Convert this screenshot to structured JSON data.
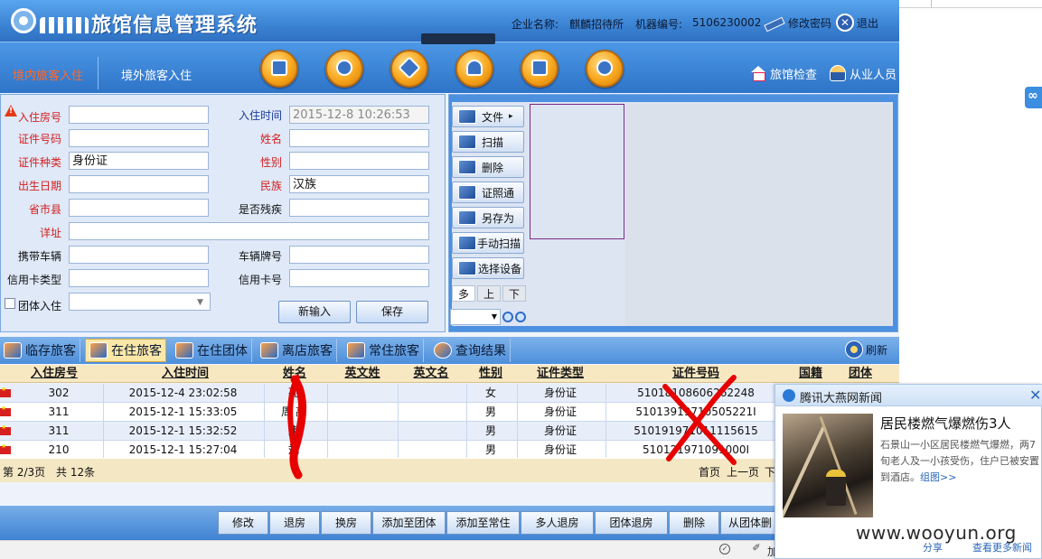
{
  "app": {
    "title": "旅馆信息管理系统",
    "company_label": "企业名称:",
    "company_name": "麒麟招待所",
    "machine_label": "机器编号:",
    "machine_no": "5106230002",
    "change_password": "修改密码",
    "logout": "退出"
  },
  "nav": {
    "tabs": [
      "境内旅客入住",
      "境外旅客入住"
    ],
    "active_tab": 0,
    "right_links": [
      "旅馆检查",
      "从业人员"
    ],
    "toolbar_icons": [
      "register-icon",
      "search-icon",
      "edit-icon",
      "user-icon",
      "house-icon",
      "info-icon"
    ]
  },
  "form": {
    "labels": {
      "room": "入住房号",
      "checkin_time": "入住时间",
      "id_no": "证件号码",
      "name": "姓名",
      "id_type": "证件种类",
      "gender": "性别",
      "birth": "出生日期",
      "ethnicity": "民族",
      "region": "省市县",
      "disabled": "是否残疾",
      "address": "详址",
      "vehicle": "携带车辆",
      "plate": "车辆牌号",
      "card_type": "信用卡类型",
      "card_no": "信用卡号",
      "group": "团体入住"
    },
    "values": {
      "room": "",
      "checkin_time": "2015-12-8 10:26:53",
      "id_no": "",
      "name": "",
      "id_type": "身份证",
      "gender": "",
      "birth": "",
      "ethnicity": "汉族",
      "region": "",
      "disabled": "",
      "address": "",
      "vehicle": "",
      "plate": "",
      "card_type": "",
      "card_no": "",
      "group": ""
    },
    "buttons": {
      "new_input": "新输入",
      "save": "保存"
    }
  },
  "scanner": {
    "buttons": [
      "文件",
      "扫描",
      "删除",
      "证照通",
      "另存为",
      "手动扫描",
      "选择设备"
    ],
    "file_arrow": "▸",
    "pager": [
      "多",
      "上",
      "下"
    ]
  },
  "guest_tabs": {
    "tabs": [
      "临存旅客",
      "在住旅客",
      "在住团体",
      "离店旅客",
      "常住旅客",
      "查询结果"
    ],
    "active": 1,
    "refresh": "刷新"
  },
  "table": {
    "columns": [
      "入住房号",
      "入住时间",
      "姓名",
      "英文姓",
      "英文名",
      "性别",
      "证件类型",
      "证件号码",
      "国籍",
      "团体"
    ],
    "rows": [
      {
        "room": "302",
        "time": "2015-12-4 23:02:58",
        "name": "孔",
        "gender": "女",
        "id_type": "身份证",
        "id_no": "51018108606262248"
      },
      {
        "room": "311",
        "time": "2015-12-1 15:33:05",
        "name": "周 高",
        "gender": "男",
        "id_type": "身份证",
        "id_no": "51013919710505221I"
      },
      {
        "room": "311",
        "time": "2015-12-1 15:32:52",
        "name": "康",
        "gender": "男",
        "id_type": "身份证",
        "id_no": "510191971011115615"
      },
      {
        "room": "210",
        "time": "2015-12-1 15:27:04",
        "name": "斌",
        "gender": "男",
        "id_type": "身份证",
        "id_no": "510121971091000I"
      }
    ],
    "pager": {
      "page": "第 2/3页",
      "total": "共 12条",
      "first": "首页",
      "prev": "上一页",
      "next": "下"
    }
  },
  "actions": [
    "修改",
    "退房",
    "换房",
    "添加至团体",
    "添加至常住",
    "多人退房",
    "团体退房",
    "删除",
    "从团体删"
  ],
  "popup": {
    "source": "腾讯大燕网新闻",
    "headline": "居民楼燃气爆燃伤3人",
    "body": "石景山一小区居民楼燃气爆燃，两7旬老人及一小孩受伤，住户已被安置到酒店。",
    "more": "组图>>",
    "share": "分享",
    "more_news": "查看更多新闻"
  },
  "statusbar": {
    "add": "加"
  },
  "watermark": "www.wooyun.org",
  "colors": {
    "header_blue": "#3e86d6",
    "label_red": "#d42020",
    "active_tab_orange": "#ff6a2a",
    "annotation_red": "#e60000"
  }
}
